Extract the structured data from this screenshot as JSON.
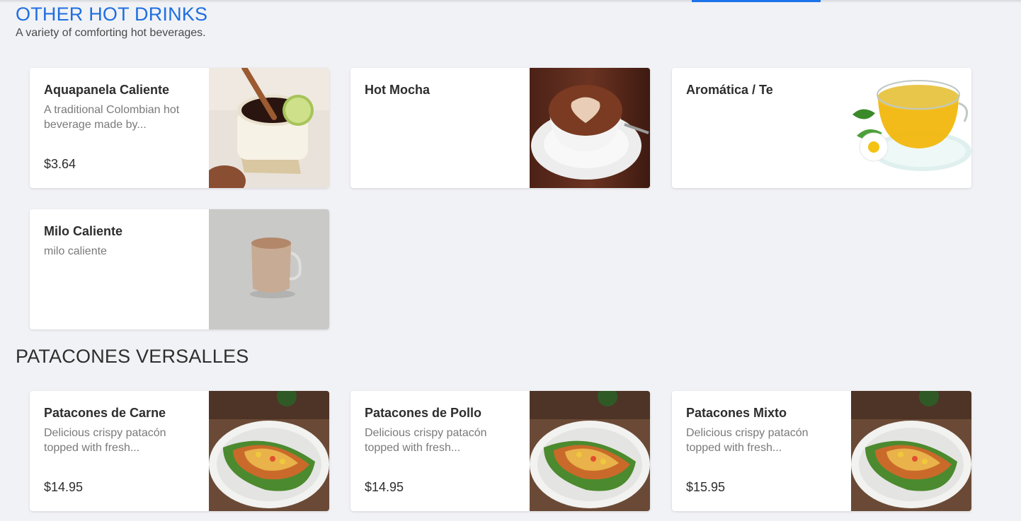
{
  "sections": [
    {
      "title": "OTHER HOT DRINKS",
      "subtitle": "A variety of comforting hot beverages.",
      "items": [
        {
          "name": "Aquapanela Caliente",
          "description": "A traditional Colombian hot beverage made by...",
          "price": "$3.64",
          "image": "aguapanela-photo"
        },
        {
          "name": "Hot Mocha",
          "description": "",
          "price": "",
          "image": "hot-mocha-photo"
        },
        {
          "name": "Aromática / Te",
          "description": "",
          "price": "",
          "image": "tea-photo"
        },
        {
          "name": "Milo Caliente",
          "description": "milo caliente",
          "price": "",
          "image": "milo-photo"
        }
      ]
    },
    {
      "title": "PATACONES VERSALLES",
      "items": [
        {
          "name": "Patacones de Carne",
          "description": "Delicious crispy patacón topped with fresh...",
          "price": "$14.95",
          "image": "patacon-photo"
        },
        {
          "name": "Patacones de Pollo",
          "description": "Delicious crispy patacón topped with fresh...",
          "price": "$14.95",
          "image": "patacon-photo"
        },
        {
          "name": "Patacones Mixto",
          "description": "Delicious crispy patacón topped with fresh...",
          "price": "$15.95",
          "image": "patacon-photo"
        }
      ]
    }
  ],
  "colors": {
    "accent": "#1f6fe0",
    "background": "#f1f2f6",
    "card": "#ffffff"
  }
}
